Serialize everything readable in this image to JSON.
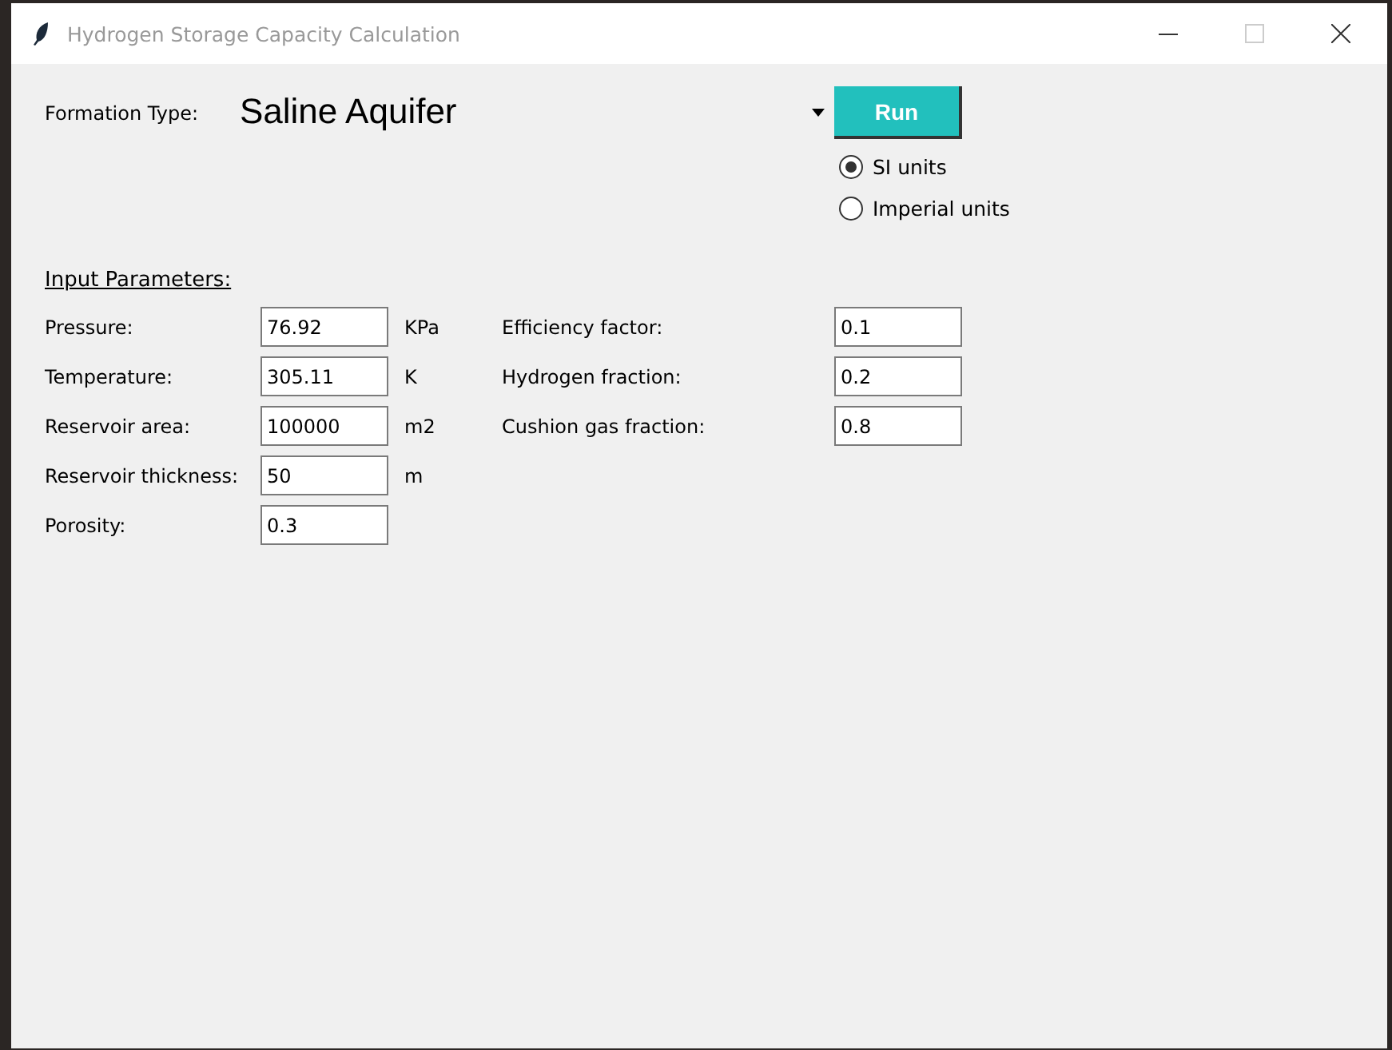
{
  "window": {
    "title": "Hydrogen Storage Capacity Calculation"
  },
  "formation": {
    "label": "Formation Type:",
    "value": "Saline Aquifer"
  },
  "run_button": "Run",
  "units": [
    {
      "label": "SI units",
      "selected": true
    },
    {
      "label": "Imperial units",
      "selected": false
    }
  ],
  "section_title": "Input Parameters:",
  "params_left": [
    {
      "label": "Pressure:",
      "value": "76.92",
      "unit": "KPa"
    },
    {
      "label": "Temperature:",
      "value": "305.11",
      "unit": "K"
    },
    {
      "label": "Reservoir area:",
      "value": "100000",
      "unit": "m2"
    },
    {
      "label": "Reservoir thickness:",
      "value": "50",
      "unit": "m"
    },
    {
      "label": "Porosity:",
      "value": "0.3"
    }
  ],
  "params_right": [
    {
      "label": "Efficiency factor:",
      "value": "0.1"
    },
    {
      "label": "Hydrogen fraction:",
      "value": "0.2"
    },
    {
      "label": "Cushion gas fraction:",
      "value": "0.8"
    }
  ]
}
